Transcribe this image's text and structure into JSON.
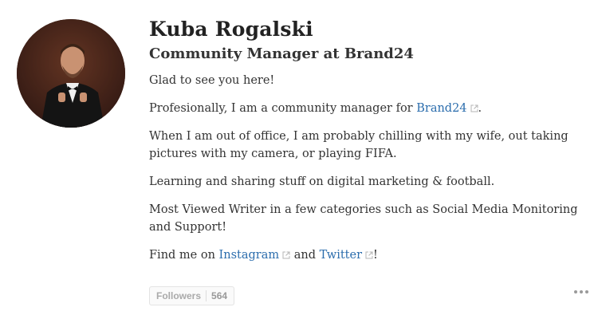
{
  "profile": {
    "name": "Kuba Rogalski",
    "title": "Community Manager at Brand24"
  },
  "bio": {
    "p1": "Glad to see you here!",
    "p2_prefix": "Profesionally, I am a community manager for ",
    "p2_link": "Brand24",
    "p2_suffix": ".",
    "p3": "When I am out of office, I am probably chilling with my wife, out taking pictures with my camera, or playing FIFA.",
    "p4": "Learning and sharing stuff on digital marketing & football.",
    "p5": "Most Viewed Writer in a few categories such as Social Media Monitoring and Support!",
    "p6_prefix": "Find me on ",
    "p6_link1": "Instagram",
    "p6_middle": " and ",
    "p6_link2": "Twitter",
    "p6_suffix": "!"
  },
  "followers": {
    "label": "Followers",
    "count": "564"
  },
  "icons": {
    "external_link": "external-link-icon",
    "more": "more-options-icon"
  },
  "colors": {
    "link": "#2b6dad",
    "text": "#333333"
  }
}
